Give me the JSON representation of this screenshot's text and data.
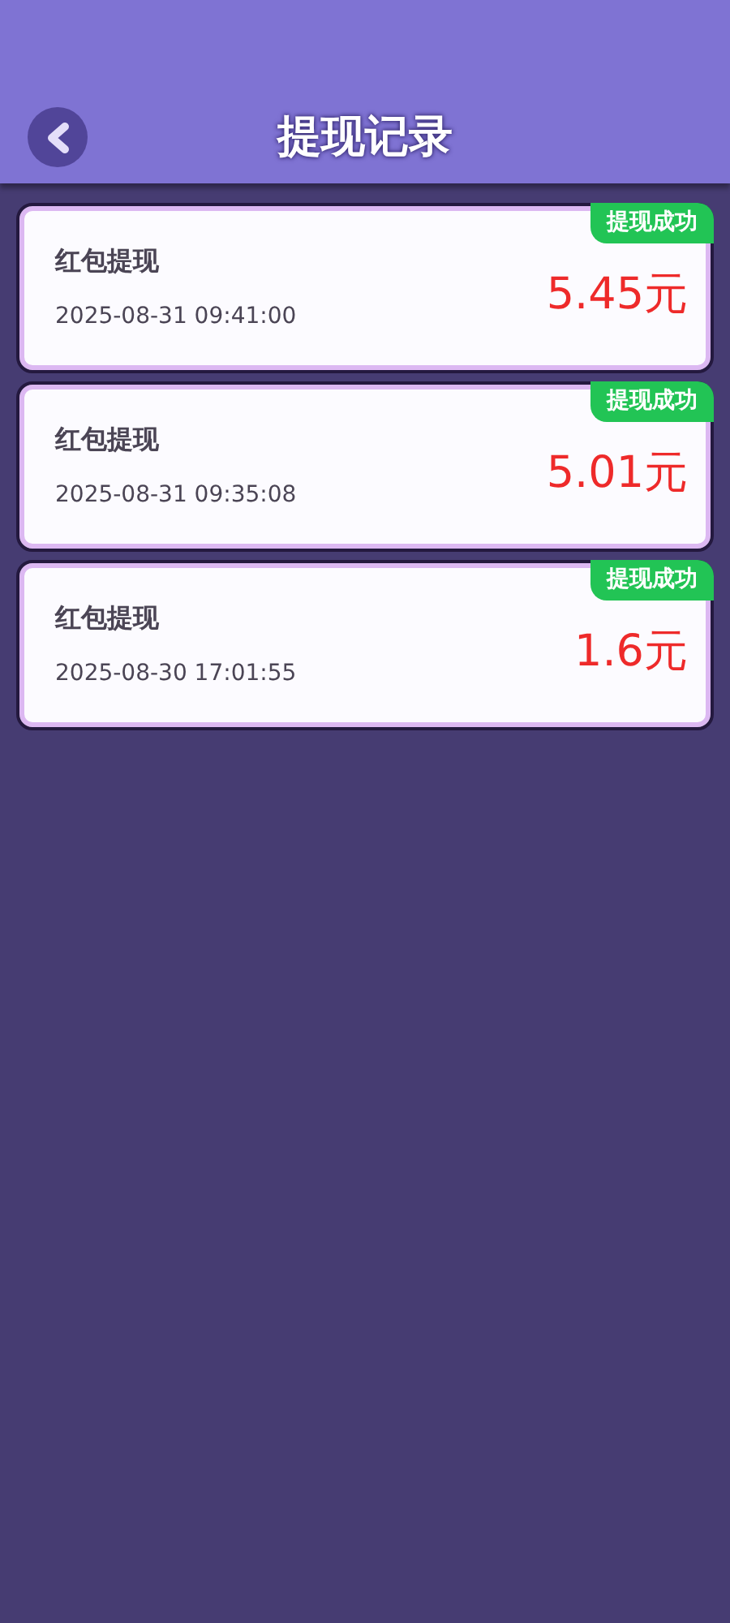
{
  "header": {
    "title": "提现记录"
  },
  "records": [
    {
      "title": "红包提现",
      "time": "2025-08-31 09:41:00",
      "amount": "5.45元",
      "status": "提现成功"
    },
    {
      "title": "红包提现",
      "time": "2025-08-31 09:35:08",
      "amount": "5.01元",
      "status": "提现成功"
    },
    {
      "title": "红包提现",
      "time": "2025-08-30 17:01:55",
      "amount": "1.6元",
      "status": "提现成功"
    }
  ]
}
